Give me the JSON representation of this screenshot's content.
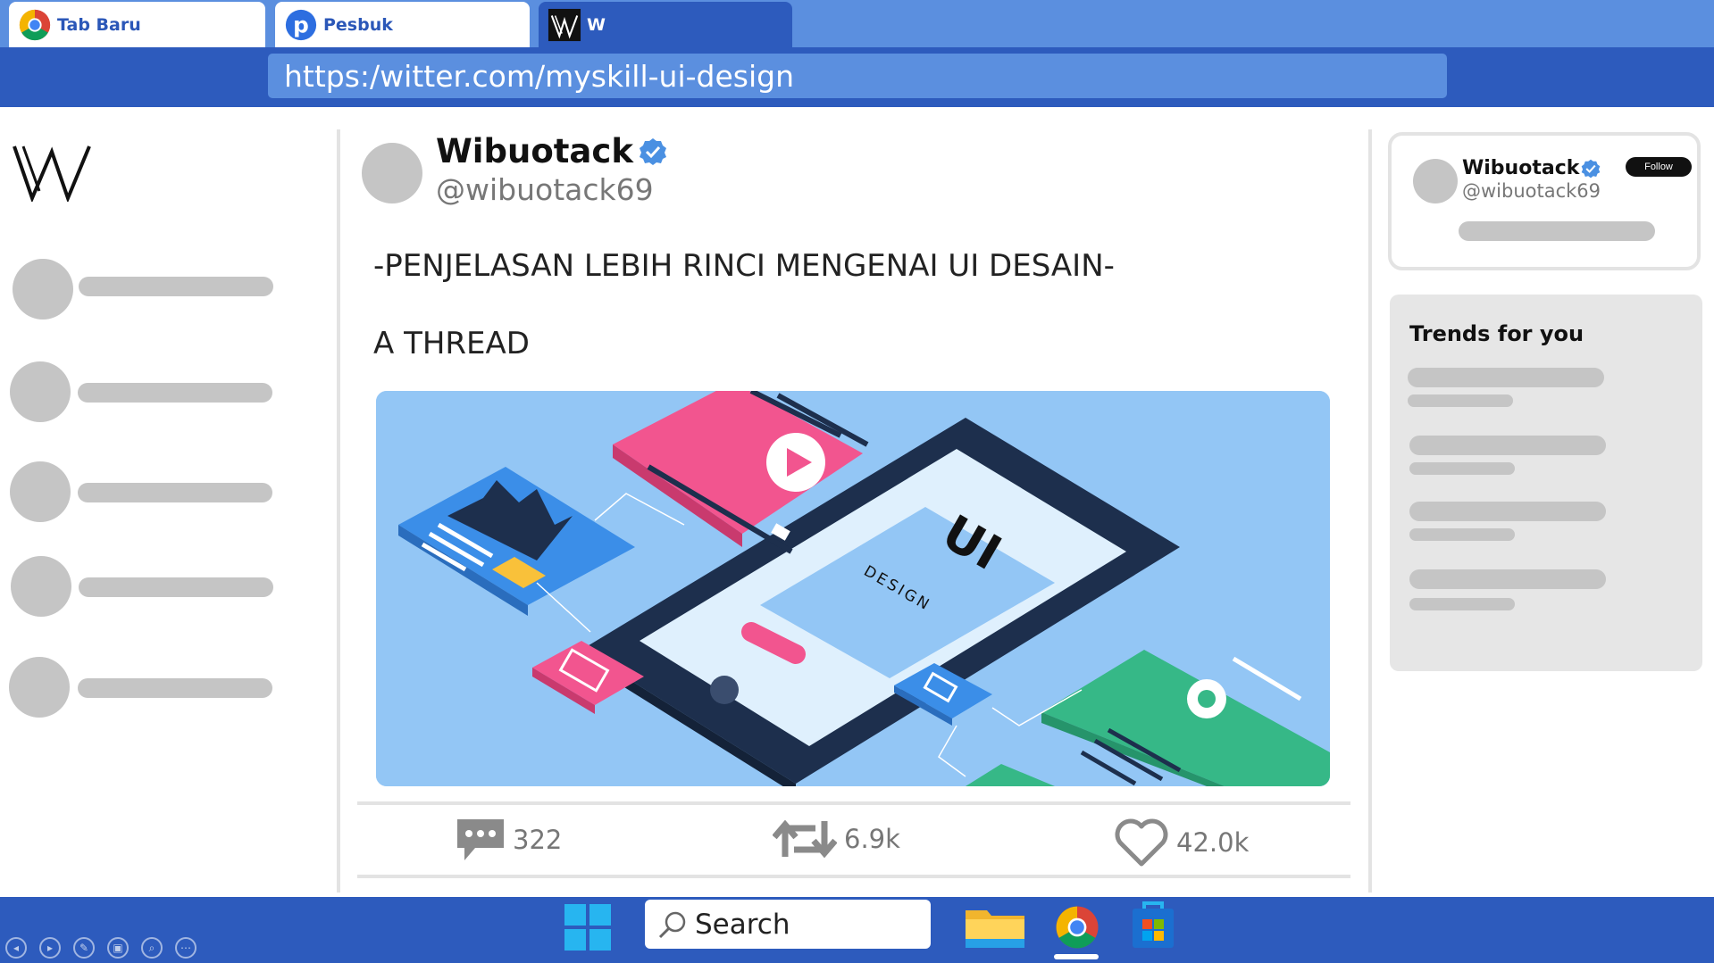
{
  "browser": {
    "tabs": [
      {
        "label": "Tab Baru",
        "icon": "chrome-icon",
        "active": false
      },
      {
        "label": "Pesbuk",
        "icon": "pesbuk-icon",
        "active": false
      },
      {
        "label": "W",
        "icon": "witter-logo-icon",
        "active": true
      }
    ],
    "url": "https:/witter.com/myskill-ui-design"
  },
  "colors": {
    "tabbar": "#5b8fdf",
    "urlbar": "#2d5bbd",
    "placeholder": "#c5c5c5",
    "verified": "#4a90e2"
  },
  "sidebar": {
    "logo_icon": "witter-logo-icon",
    "items": [
      {
        "icon": "placeholder-avatar"
      },
      {
        "icon": "placeholder-avatar"
      },
      {
        "icon": "placeholder-avatar"
      },
      {
        "icon": "placeholder-avatar"
      },
      {
        "icon": "placeholder-avatar"
      }
    ]
  },
  "tweet": {
    "name": "Wibuotack",
    "handle": "@wibuotack69",
    "verified": true,
    "line1": "-PENJELASAN LEBIH RINCI MENGENAI UI DESAIN-",
    "line2": "A THREAD",
    "image_text_main": "UI",
    "image_text_sub": "DESIGN",
    "stats": {
      "replies": "322",
      "retweets": "6.9k",
      "likes": "42.0k"
    }
  },
  "profile_card": {
    "name": "Wibuotack",
    "handle": "@wibuotack69",
    "follow_label": "Follow"
  },
  "trends": {
    "title": "Trends for you",
    "count": 4
  },
  "taskbar": {
    "search_label": "Search",
    "apps": [
      "windows-start-icon",
      "file-explorer-icon",
      "chrome-icon",
      "store-icon"
    ]
  }
}
